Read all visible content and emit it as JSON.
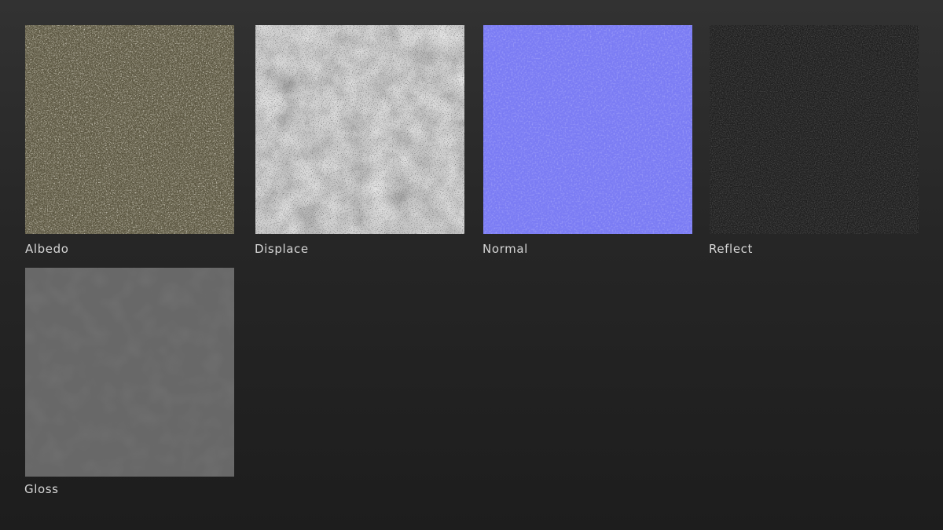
{
  "maps": [
    {
      "label": "Albedo"
    },
    {
      "label": "Displace"
    },
    {
      "label": "Normal"
    },
    {
      "label": "Reflect"
    },
    {
      "label": "Gloss"
    }
  ]
}
